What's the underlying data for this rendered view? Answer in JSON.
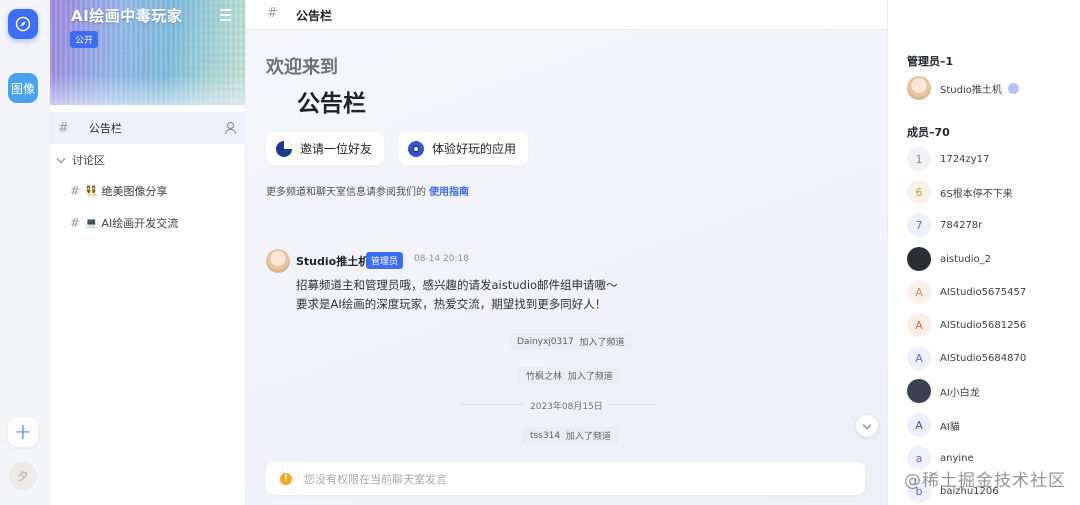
{
  "rail": {
    "image_label": "图像",
    "add_label": "+",
    "avatar_glyph": "夕"
  },
  "server": {
    "name": "AI绘画中毒玩家",
    "visibility_badge": "公开"
  },
  "sidebar": {
    "active_channel": "公告栏",
    "category": "讨论区",
    "channels": [
      {
        "emoji": "👯",
        "label": "绝美图像分享"
      },
      {
        "emoji": "💻",
        "label": "AI绘画开发交流"
      }
    ]
  },
  "topbar": {
    "channel_title": "公告栏"
  },
  "welcome": {
    "line1": "欢迎来到",
    "channel": "公告栏",
    "invite_label": "邀请一位好友",
    "app_label": "体验好玩的应用",
    "guide_text": "更多频道和聊天室信息请参阅我们的",
    "guide_link": "使用指南"
  },
  "message": {
    "author": "Studio推土机",
    "role": "管理员",
    "time": "08-14 20:18",
    "lines": [
      "招募频道主和管理员哦，感兴趣的请发aistudio邮件组申请嗷～",
      "要求是AI绘画的深度玩家，热爱交流，期望找到更多同好人！"
    ]
  },
  "system_events": [
    {
      "user": "Dainyxj0317",
      "action": "加入了频道"
    },
    {
      "user": "竹枫之林",
      "action": "加入了频道"
    },
    {
      "user": "tss314",
      "action": "加入了频道"
    }
  ],
  "date_divider": "2023年08月15日",
  "composer": {
    "placeholder": "您没有权限在当前聊天室发言"
  },
  "members": {
    "admin_title": "管理员–1",
    "admins": [
      {
        "name": "Studio推土机"
      }
    ],
    "member_title": "成员–70",
    "list": [
      {
        "initial": "1",
        "name": "1724zy17",
        "color": "#8a8f96",
        "bg": "#f1f2f4"
      },
      {
        "initial": "6",
        "name": "6S根本停不下来",
        "color": "#d4a03a",
        "bg": "#f8f3e6"
      },
      {
        "initial": "7",
        "name": "784278r",
        "color": "#5b6fd6",
        "bg": "#eef0fb"
      },
      {
        "initial": "",
        "name": "aistudio_2",
        "color": "#ffffff",
        "bg": "#2a2d36"
      },
      {
        "initial": "A",
        "name": "AIStudio5675457",
        "color": "#d98a52",
        "bg": "#fbf1ea"
      },
      {
        "initial": "A",
        "name": "AIStudio5681256",
        "color": "#d9663f",
        "bg": "#fbeee9"
      },
      {
        "initial": "A",
        "name": "AIStudio5684870",
        "color": "#5b6fd6",
        "bg": "#eef0fb"
      },
      {
        "initial": "",
        "name": "AI小白龙",
        "color": "#ffffff",
        "bg": "#3b4150"
      },
      {
        "initial": "A",
        "name": "AI貓",
        "color": "#3d4fb8",
        "bg": "#eef0fb"
      },
      {
        "initial": "a",
        "name": "anyine",
        "color": "#5b6fd6",
        "bg": "#eef0fb"
      },
      {
        "initial": "b",
        "name": "baizhu1206",
        "color": "#5b6fd6",
        "bg": "#eef0fb"
      }
    ]
  },
  "watermark": "@稀土掘金技术社区",
  "icons": {
    "compass": "compass-icon",
    "bell": "bell-icon",
    "pin": "pin-icon",
    "users": "users-icon",
    "apps": "apps-grid-icon"
  },
  "colors": {
    "accent": "#3d6cf5",
    "warning": "#f5a623"
  }
}
